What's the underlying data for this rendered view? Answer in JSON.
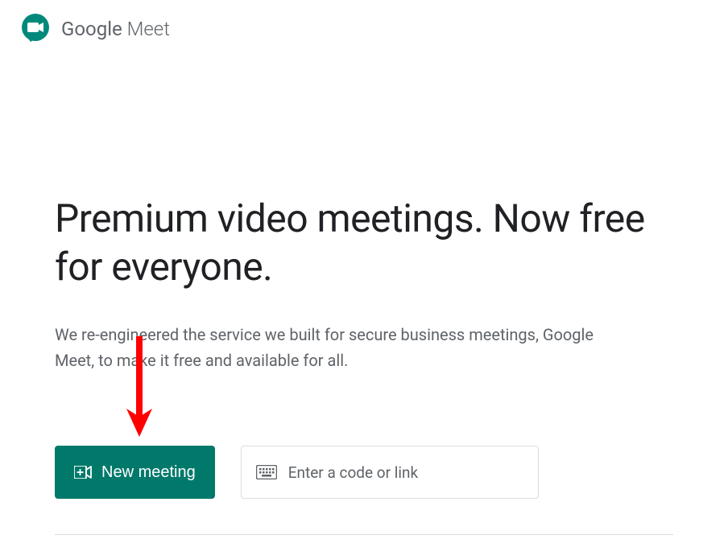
{
  "header": {
    "logo_text_bold": "Google",
    "logo_text_light": " Meet"
  },
  "main": {
    "headline": "Premium video meetings. Now free for everyone.",
    "subtext": "We re-engineered the service we built for secure business meetings, Google Meet, to make it free and available for all.",
    "new_meeting_label": "New meeting",
    "code_input_placeholder": "Enter a code or link"
  }
}
